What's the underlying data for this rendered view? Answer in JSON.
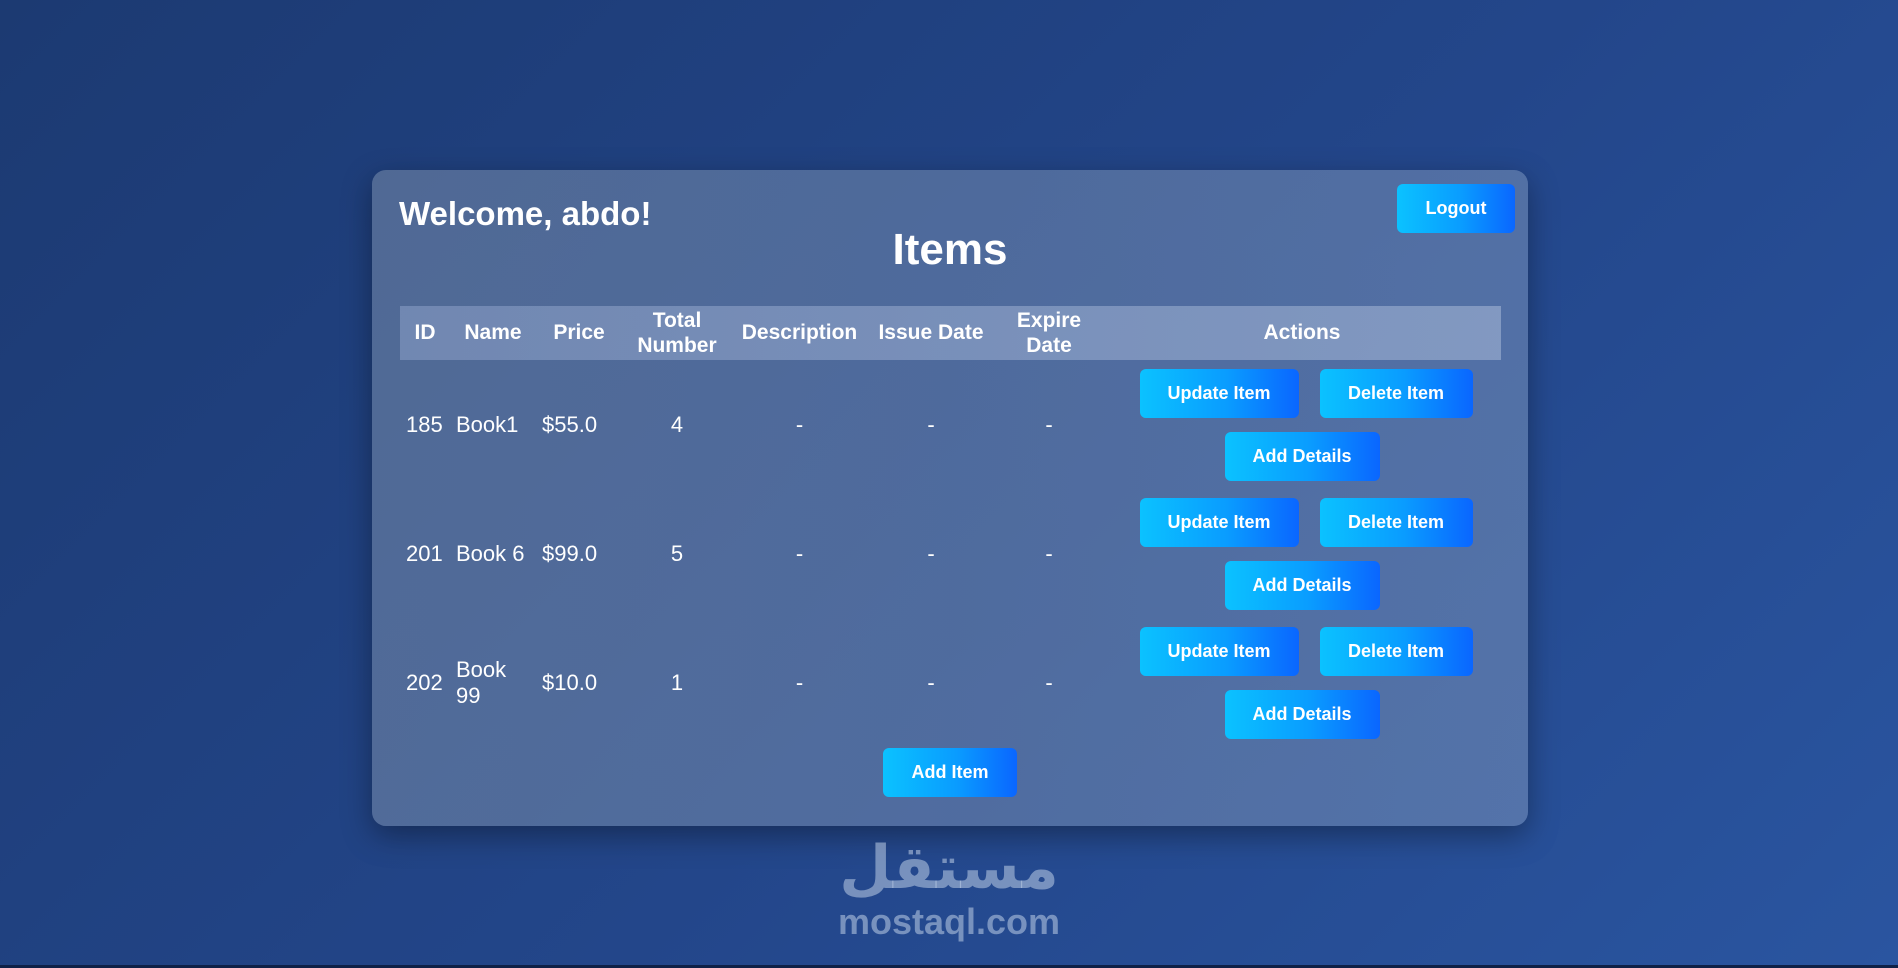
{
  "header": {
    "welcome": "Welcome, abdo!",
    "logout_label": "Logout"
  },
  "main": {
    "title": "Items",
    "columns": [
      "ID",
      "Name",
      "Price",
      "Total Number",
      "Description",
      "Issue Date",
      "Expire Date",
      "Actions"
    ],
    "rows": [
      {
        "id": "185",
        "name": "Book1",
        "price": "$55.0",
        "total": "4",
        "description": "-",
        "issue_date": "-",
        "expire_date": "-"
      },
      {
        "id": "201",
        "name": "Book 6",
        "price": "$99.0",
        "total": "5",
        "description": "-",
        "issue_date": "-",
        "expire_date": "-"
      },
      {
        "id": "202",
        "name": "Book 99",
        "price": "$10.0",
        "total": "1",
        "description": "-",
        "issue_date": "-",
        "expire_date": "-"
      }
    ],
    "actions": {
      "update_label": "Update Item",
      "delete_label": "Delete Item",
      "details_label": "Add Details"
    },
    "add_item_label": "Add Item"
  },
  "watermark": {
    "arabic": "مستقل",
    "latin": "mostaql.com"
  },
  "colors": {
    "background": "#23468a",
    "button_start": "#0bc2ff",
    "button_end": "#0a66ff"
  }
}
